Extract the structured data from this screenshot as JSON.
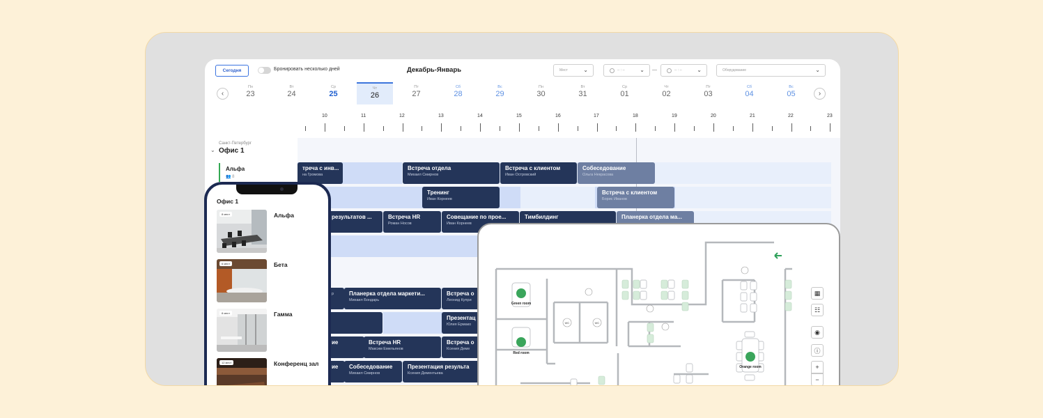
{
  "toolbar": {
    "today": "Сегодня",
    "multi_days": "Бронировать несколько дней",
    "month": "Декабрь-Январь",
    "seats_placeholder": "Мест",
    "time_from_placeholder": "-- : --",
    "time_to_placeholder": "-- : --",
    "equipment_placeholder": "Оборудование"
  },
  "days": [
    {
      "name": "Пн",
      "date": "23"
    },
    {
      "name": "Вт",
      "date": "24"
    },
    {
      "name": "Ср",
      "date": "25"
    },
    {
      "name": "Чт",
      "date": "26"
    },
    {
      "name": "Пт",
      "date": "27"
    },
    {
      "name": "Сб",
      "date": "28"
    },
    {
      "name": "Вс",
      "date": "29"
    },
    {
      "name": "Пн",
      "date": "30"
    },
    {
      "name": "Вт",
      "date": "31"
    },
    {
      "name": "Ср",
      "date": "01"
    },
    {
      "name": "Чт",
      "date": "02"
    },
    {
      "name": "Пт",
      "date": "03"
    },
    {
      "name": "Сб",
      "date": "04"
    },
    {
      "name": "Вс",
      "date": "05"
    }
  ],
  "hours": [
    "10",
    "11",
    "12",
    "13",
    "14",
    "15",
    "16",
    "17",
    "18",
    "19",
    "20",
    "21",
    "22",
    "23"
  ],
  "location": {
    "city": "Санкт-Петербург",
    "office": "Офис 1"
  },
  "room": {
    "name": "Альфа",
    "capacity": "8"
  },
  "events": [
    {
      "title": "треча с инв...",
      "person": "на Громова"
    },
    {
      "title": "Встреча отдела",
      "person": "Михаил Смирнов"
    },
    {
      "title": "Встреча с клиентом",
      "person": "Иван Островский"
    },
    {
      "title": "Собеседование",
      "person": "Ольга Некрасова"
    },
    {
      "title": "Тренинг",
      "person": "Иван Корнеев"
    },
    {
      "title": "Встреча с клиентом",
      "person": "Борис Иванов"
    },
    {
      "title": "результатов ...",
      "person": ""
    },
    {
      "title": "Встреча HR",
      "person": "Роман Носов"
    },
    {
      "title": "Совещание по прое...",
      "person": "Иван Корнеев"
    },
    {
      "title": "Тимбилдинг",
      "person": ""
    },
    {
      "title": "Планерка отдела ма...",
      "person": ""
    },
    {
      "title": "Планерка отдела маркети...",
      "person": "Михаил Бондарь"
    },
    {
      "title": "Встреча о",
      "person": "Леонид Купри"
    },
    {
      "title": "Презентац",
      "person": "Юлия Ермако"
    },
    {
      "title": "ие",
      "person": ""
    },
    {
      "title": "Встреча HR",
      "person": "Максим Емельянов"
    },
    {
      "title": "Встреча о",
      "person": "Ксения Деме"
    },
    {
      "title": "ие",
      "person": ""
    },
    {
      "title": "Собеседование",
      "person": "Михаил Смирнов"
    },
    {
      "title": "Презентация результа",
      "person": "Ксения Дементьева"
    },
    {
      "title": "",
      "person": "р"
    }
  ],
  "phone": {
    "title": "Офис 1",
    "rooms": [
      {
        "name": "Альфа",
        "badge": "8 мест"
      },
      {
        "name": "Бета",
        "badge": "6 мест"
      },
      {
        "name": "Гамма",
        "badge": "8 мест"
      },
      {
        "name": "Конференц зал",
        "badge": "12 мест"
      }
    ]
  },
  "map": {
    "labels": {
      "green": "Green room",
      "red": "Red room",
      "orange": "Orange room",
      "wc": "WC"
    }
  },
  "colors": {
    "accent": "#3b74dc",
    "event": "#243559",
    "event_muted": "#6e7fa2",
    "lane": "#e8effb",
    "room_green": "#34a853"
  }
}
